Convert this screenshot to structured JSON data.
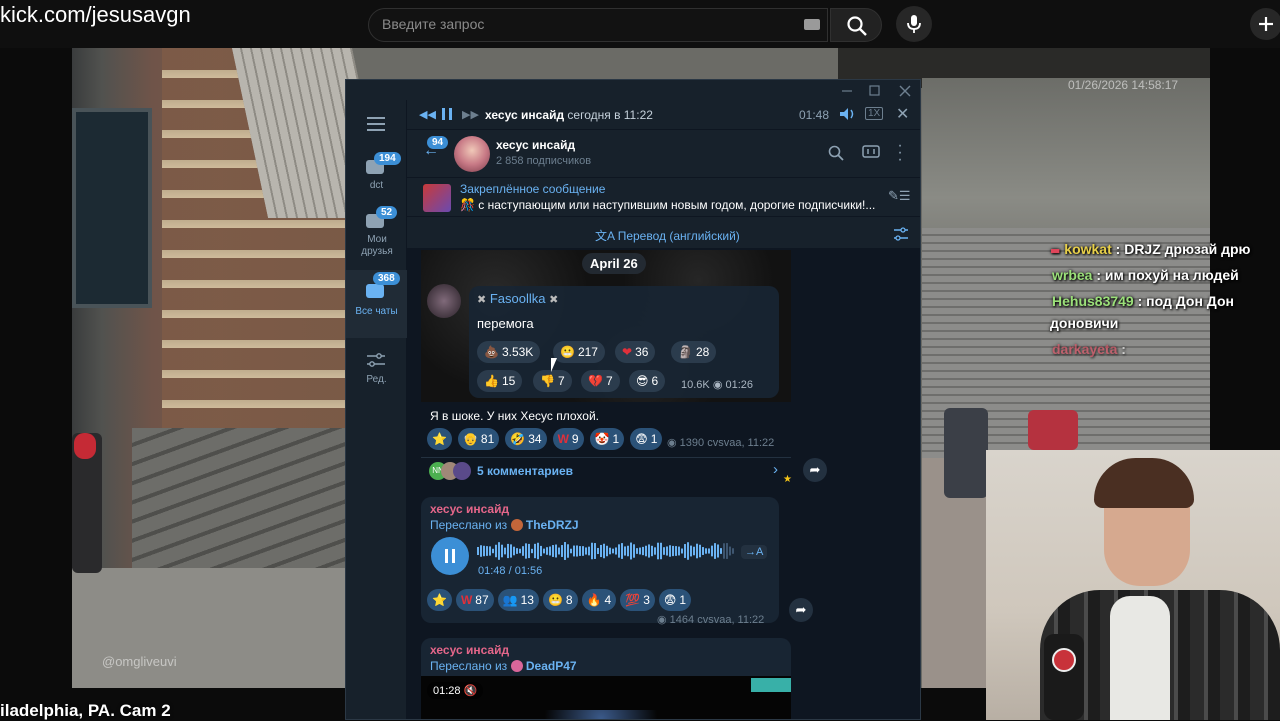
{
  "browser": {
    "url": "kick.com/jesusavgn",
    "search_placeholder": "Введите запрос"
  },
  "stream": {
    "caption": "iladelphia, PA. Cam 2",
    "timestamp_overlay": "01/26/2026 14:58:17",
    "watermark": "@omgliveuvi"
  },
  "chat": [
    {
      "user": "kowkat",
      "text": ": DRJZ дрюзай дрю",
      "color": "#e8d04a"
    },
    {
      "user": "wrbea",
      "text": ": им похуй на людей",
      "color": "#9be07a"
    },
    {
      "user": "Hehus83749",
      "text": ": под Дон Дон",
      "color": "#9be07a"
    },
    {
      "user": "",
      "text": "доновичи",
      "color": "#ffffff"
    },
    {
      "user": "darkayeta",
      "text": ":",
      "color": "#e0455a"
    }
  ],
  "telegram": {
    "player": {
      "title": "хесус инсайд",
      "subtitle": "сегодня в 11:22",
      "time": "01:48",
      "speed": "1X"
    },
    "channel": {
      "name": "хесус инсайд",
      "subscribers": "2 858 подписчиков",
      "unread": "94"
    },
    "sidebar": [
      {
        "label": "dct",
        "badge": "194"
      },
      {
        "label": "Мои друзья",
        "badge": "52"
      },
      {
        "label": "Все чаты",
        "badge": "368"
      },
      {
        "label": "Ред.",
        "badge": ""
      }
    ],
    "pinned": {
      "title": "Закреплённое сообщение",
      "text": "с наступающим или наступившим новым годом, дорогие подписчики!..."
    },
    "translate_label": "Перевод (английский)",
    "date_chip": "April 26",
    "post1": {
      "author": "Fasoollka",
      "text": "перемога",
      "reactions_row1": [
        {
          "emoji": "💩",
          "count": "3.53K"
        },
        {
          "emoji": "😬",
          "count": "217"
        },
        {
          "emoji": "❤",
          "count": "36"
        },
        {
          "emoji": "🗿",
          "count": "28"
        }
      ],
      "reactions_row2": [
        {
          "emoji": "👍",
          "count": "15"
        },
        {
          "emoji": "👎",
          "count": "7"
        },
        {
          "emoji": "💔",
          "count": "7"
        },
        {
          "emoji": "😎",
          "count": "6"
        }
      ],
      "views": "10.6K",
      "time": "01:26",
      "caption": "Я в шоке. У них Хесус плохой.",
      "reactions_row3": [
        {
          "emoji": "⭐",
          "count": ""
        },
        {
          "emoji": "👴",
          "count": "81"
        },
        {
          "emoji": "🤣",
          "count": "34"
        },
        {
          "emoji": "W",
          "count": "9"
        },
        {
          "emoji": "🤡",
          "count": "1"
        },
        {
          "emoji": "😨",
          "count": "1"
        }
      ],
      "views2": "1390",
      "signature": "cvsvaa, 11:22",
      "comments": "5 комментариев"
    },
    "post2": {
      "author": "хесус инсайд",
      "forwarded_label": "Переслано из",
      "forwarded_from": "TheDRZJ",
      "audio_time": "01:48 / 01:56",
      "transcribe": "→A",
      "reactions": [
        {
          "emoji": "⭐",
          "count": ""
        },
        {
          "emoji": "W",
          "count": "87"
        },
        {
          "emoji": "👥",
          "count": "13"
        },
        {
          "emoji": "😬",
          "count": "8"
        },
        {
          "emoji": "🔥",
          "count": "4"
        },
        {
          "emoji": "💯",
          "count": "3"
        },
        {
          "emoji": "😨",
          "count": "1"
        }
      ],
      "views": "1464",
      "signature": "cvsvaa, 11:22"
    },
    "post3": {
      "author": "хесус инсайд",
      "forwarded_label": "Переслано из",
      "forwarded_from": "DeadP47",
      "video_time": "01:28"
    }
  },
  "colors": {
    "tg_bg": "#17212b",
    "tg_feed": "#0e1621",
    "tg_accent": "#6ab2f2",
    "tg_bubble": "#182533"
  }
}
